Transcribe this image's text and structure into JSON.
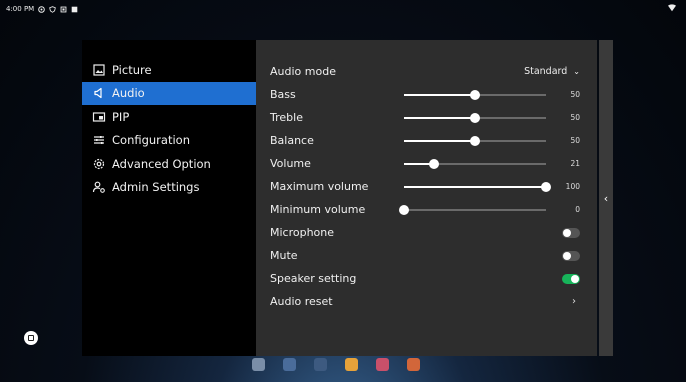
{
  "statusbar": {
    "time": "4:00 PM"
  },
  "menu": {
    "items": [
      {
        "label": "Picture",
        "icon": "picture-icon",
        "active": false
      },
      {
        "label": "Audio",
        "icon": "speaker-icon",
        "active": true
      },
      {
        "label": "PIP",
        "icon": "pip-icon",
        "active": false
      },
      {
        "label": "Configuration",
        "icon": "configuration-icon",
        "active": false
      },
      {
        "label": "Advanced Option",
        "icon": "gear-icon",
        "active": false
      },
      {
        "label": "Admin Settings",
        "icon": "admin-icon",
        "active": false
      }
    ]
  },
  "audio": {
    "audio_mode": {
      "label": "Audio mode",
      "value": "Standard"
    },
    "sliders": [
      {
        "label": "Bass",
        "value": "50",
        "level": 0.5
      },
      {
        "label": "Treble",
        "value": "50",
        "level": 0.5
      },
      {
        "label": "Balance",
        "value": "50",
        "level": 0.5
      },
      {
        "label": "Volume",
        "value": "21",
        "level": 0.21
      },
      {
        "label": "Maximum volume",
        "value": "100",
        "level": 1.0
      },
      {
        "label": "Minimum volume",
        "value": "0",
        "level": 0.0
      }
    ],
    "toggles": [
      {
        "label": "Microphone",
        "on": false
      },
      {
        "label": "Mute",
        "on": false
      },
      {
        "label": "Speaker setting",
        "on": true
      }
    ],
    "reset": {
      "label": "Audio reset"
    }
  },
  "colors": {
    "accent": "#1f6fd1",
    "toggle_on": "#17b45a"
  }
}
